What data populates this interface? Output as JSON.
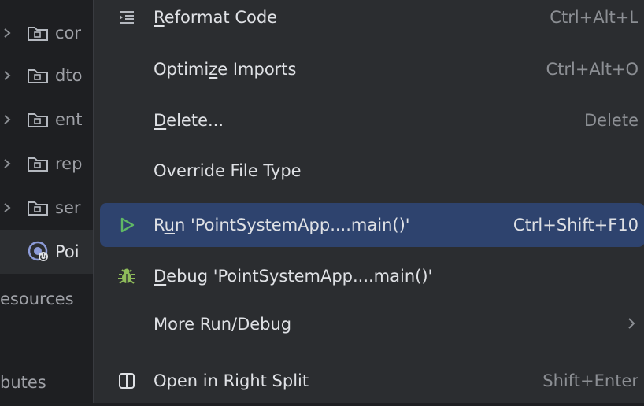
{
  "tree": {
    "rows": [
      {
        "label": "cor",
        "type": "folder"
      },
      {
        "label": "dto",
        "type": "folder"
      },
      {
        "label": "ent",
        "type": "folder"
      },
      {
        "label": "rep",
        "type": "folder"
      },
      {
        "label": "ser",
        "type": "folder"
      },
      {
        "label": "Poi",
        "type": "app",
        "selected": true
      },
      {
        "label": "esources",
        "type": "flat"
      },
      {
        "label": "butes",
        "type": "flat"
      }
    ]
  },
  "menu": {
    "reformat": {
      "pre": "",
      "u": "R",
      "post": "eformat Code",
      "shortcut": "Ctrl+Alt+L"
    },
    "optimize": {
      "pre": "Optimi",
      "u": "z",
      "post": "e Imports",
      "shortcut": "Ctrl+Alt+O"
    },
    "delete": {
      "pre": "",
      "u": "D",
      "post": "elete...",
      "shortcut": "Delete"
    },
    "override": {
      "label": "Override File Type"
    },
    "run": {
      "pre": "R",
      "u": "u",
      "post": "n 'PointSystemApp....main()'",
      "shortcut": "Ctrl+Shift+F10"
    },
    "debug": {
      "pre": "",
      "u": "D",
      "post": "ebug 'PointSystemApp....main()'"
    },
    "more": {
      "label": "More Run/Debug"
    },
    "split": {
      "label": "Open in Right Split",
      "shortcut": "Shift+Enter"
    }
  },
  "colors": {
    "background": "#1e1f22",
    "menu_background": "#2b2d30",
    "highlight": "#2e436e",
    "run_icon": "#5fb865",
    "debug_icon": "#8fbc5a"
  }
}
